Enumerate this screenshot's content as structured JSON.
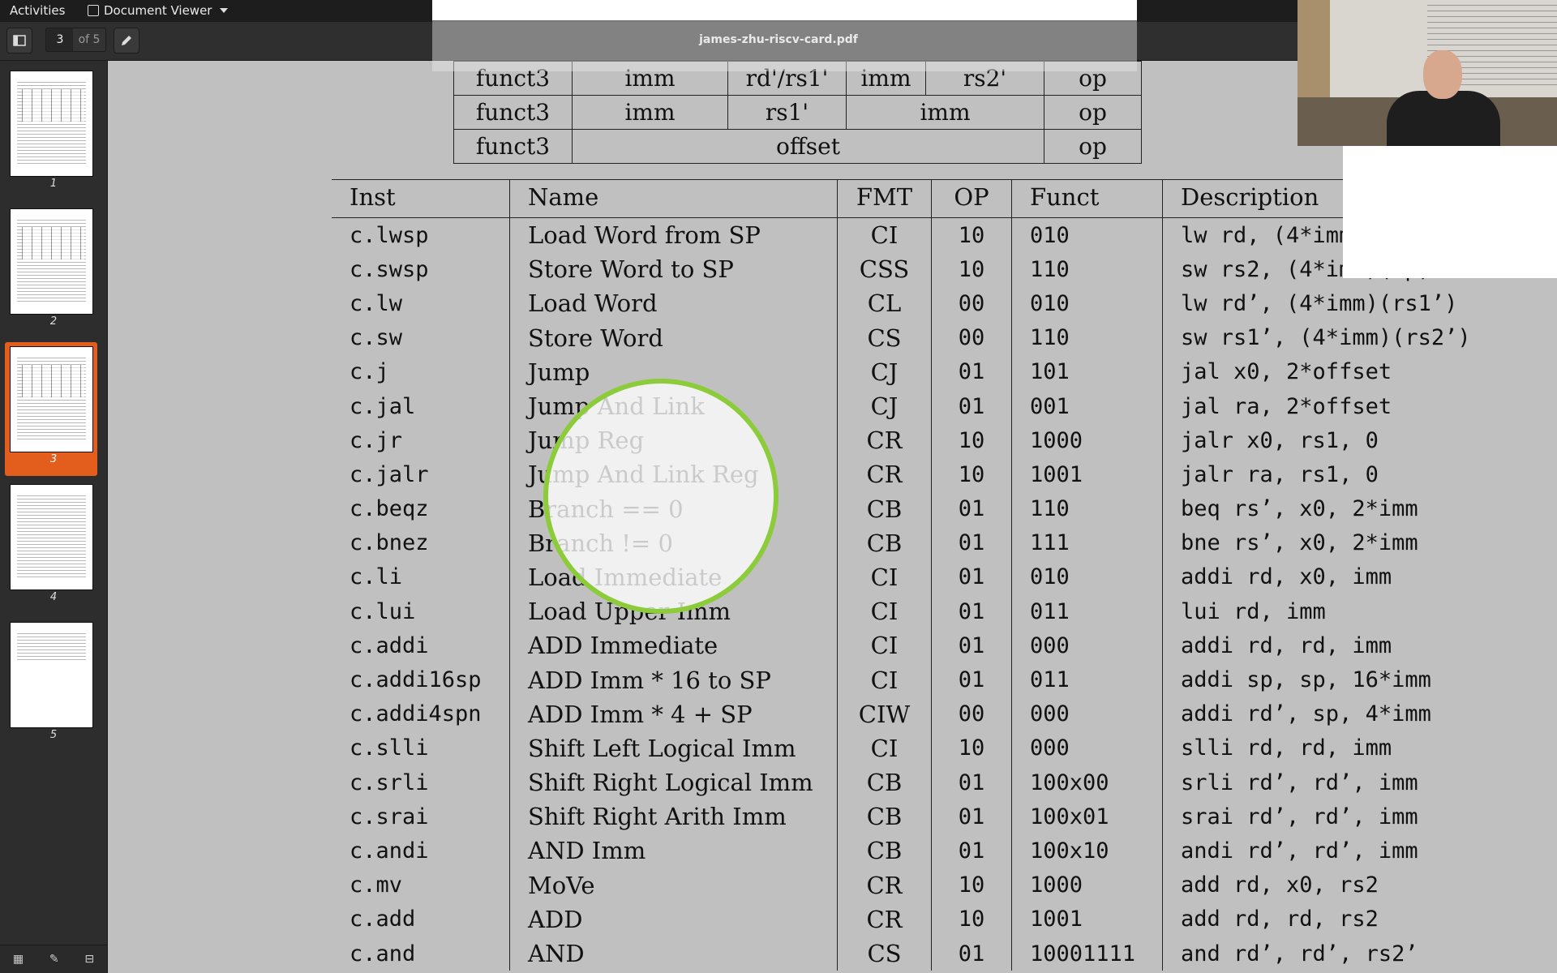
{
  "topbar": {
    "activities": "Activities",
    "app_name": "Document Viewer"
  },
  "header": {
    "page_current": "3",
    "page_of": "of 5",
    "doc_title": "james-zhu-riscv-card.pdf"
  },
  "sidebar": {
    "pages": [
      "1",
      "2",
      "3",
      "4",
      "5"
    ],
    "selected_page": "3"
  },
  "encoding_table": {
    "rows": [
      [
        "funct3",
        "imm",
        "rd'/rs1'",
        "imm",
        "rs2'",
        "op"
      ],
      [
        "funct3",
        "imm",
        "rs1'",
        "imm",
        "op"
      ],
      [
        "funct3",
        "offset",
        "op"
      ]
    ]
  },
  "inst_table": {
    "headers": [
      "Inst",
      "Name",
      "FMT",
      "OP",
      "Funct",
      "Description"
    ],
    "rows": [
      [
        "c.lwsp",
        "Load Word from SP",
        "CI",
        "10",
        "010",
        "lw rd, (4*imm)(sp)"
      ],
      [
        "c.swsp",
        "Store Word to SP",
        "CSS",
        "10",
        "110",
        "sw rs2, (4*imm)(sp)"
      ],
      [
        "c.lw",
        "Load Word",
        "CL",
        "00",
        "010",
        "lw rd’, (4*imm)(rs1’)"
      ],
      [
        "c.sw",
        "Store Word",
        "CS",
        "00",
        "110",
        "sw rs1’, (4*imm)(rs2’)"
      ],
      [
        "c.j",
        "Jump",
        "CJ",
        "01",
        "101",
        "jal x0, 2*offset"
      ],
      [
        "c.jal",
        "Jump And Link",
        "CJ",
        "01",
        "001",
        "jal ra, 2*offset"
      ],
      [
        "c.jr",
        "Jump Reg",
        "CR",
        "10",
        "1000",
        "jalr x0, rs1, 0"
      ],
      [
        "c.jalr",
        "Jump And Link Reg",
        "CR",
        "10",
        "1001",
        "jalr ra, rs1, 0"
      ],
      [
        "c.beqz",
        "Branch == 0",
        "CB",
        "01",
        "110",
        "beq rs’, x0, 2*imm"
      ],
      [
        "c.bnez",
        "Branch != 0",
        "CB",
        "01",
        "111",
        "bne rs’, x0, 2*imm"
      ],
      [
        "c.li",
        "Load Immediate",
        "CI",
        "01",
        "010",
        "addi rd, x0, imm"
      ],
      [
        "c.lui",
        "Load Upper Imm",
        "CI",
        "01",
        "011",
        "lui rd, imm"
      ],
      [
        "c.addi",
        "ADD Immediate",
        "CI",
        "01",
        "000",
        "addi rd, rd, imm"
      ],
      [
        "c.addi16sp",
        "ADD Imm * 16 to SP",
        "CI",
        "01",
        "011",
        "addi sp, sp, 16*imm"
      ],
      [
        "c.addi4spn",
        "ADD Imm * 4 + SP",
        "CIW",
        "00",
        "000",
        "addi rd’, sp, 4*imm"
      ],
      [
        "c.slli",
        "Shift Left Logical Imm",
        "CI",
        "10",
        "000",
        "slli rd, rd, imm"
      ],
      [
        "c.srli",
        "Shift Right Logical Imm",
        "CB",
        "01",
        "100x00",
        "srli rd’, rd’, imm"
      ],
      [
        "c.srai",
        "Shift Right Arith Imm",
        "CB",
        "01",
        "100x01",
        "srai rd’, rd’, imm"
      ],
      [
        "c.andi",
        "AND Imm",
        "CB",
        "01",
        "100x10",
        "andi rd’, rd’, imm"
      ],
      [
        "c.mv",
        "MoVe",
        "CR",
        "10",
        "1000",
        "add rd, x0, rs2"
      ],
      [
        "c.add",
        "ADD",
        "CR",
        "10",
        "1001",
        "add rd, rd, rs2"
      ],
      [
        "c.and",
        "AND",
        "CS",
        "01",
        "10001111",
        "and rd’, rd’, rs2’"
      ]
    ]
  },
  "colors": {
    "accent": "#e35d1c",
    "magnifier": "#8ccb3a",
    "canvas": "#c0c0c0"
  }
}
